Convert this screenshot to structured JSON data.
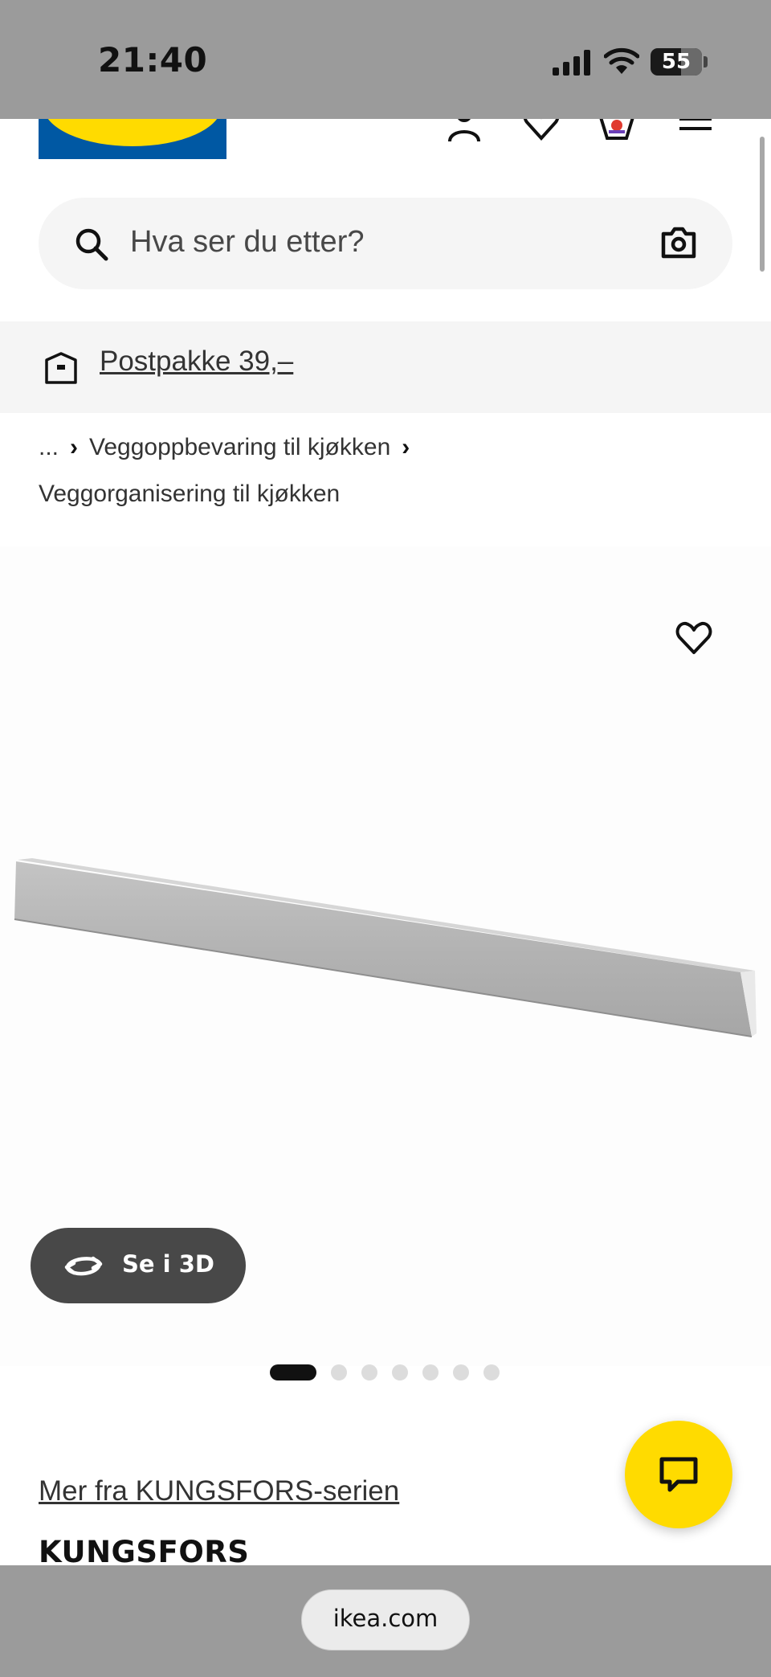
{
  "status_bar": {
    "time": "21:40",
    "battery": "55"
  },
  "search": {
    "placeholder": "Hva ser du etter?"
  },
  "promo": {
    "label": "Postpakke 39,–"
  },
  "breadcrumb": {
    "ellipsis": "...",
    "level1": "Veggoppbevaring til kjøkken",
    "level2": "Veggorganisering til kjøkken"
  },
  "product": {
    "view_3d_label": "Se i 3D",
    "gallery_total": 7,
    "gallery_active": 1,
    "series_link": "Mer fra KUNGSFORS-serien",
    "name": "KUNGSFORS"
  },
  "browser": {
    "url": "ikea.com"
  },
  "icons": {
    "status": [
      "signal-icon",
      "wifi-icon",
      "battery-icon"
    ],
    "header": [
      "account-icon",
      "wishlist-icon",
      "cart-icon",
      "menu-icon"
    ],
    "search": [
      "search-icon",
      "camera-icon"
    ],
    "promo": "parcel-icon",
    "product": [
      "favourite-icon",
      "rotate-3d-icon",
      "chat-icon"
    ]
  },
  "colors": {
    "ikea_blue": "#0058a3",
    "ikea_yellow": "#ffdb00",
    "chrome_gray": "#9b9b9b",
    "button_dark": "#484848"
  }
}
